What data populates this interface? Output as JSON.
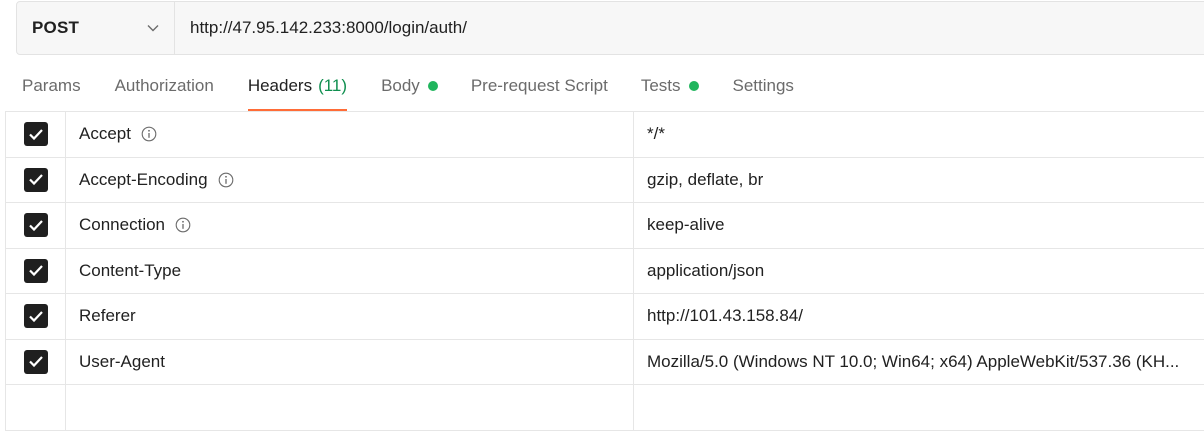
{
  "request": {
    "method": "POST",
    "url": "http://47.95.142.233:8000/login/auth/"
  },
  "tabs": {
    "params": "Params",
    "authorization": "Authorization",
    "headers": "Headers",
    "headers_count": "(11)",
    "body": "Body",
    "pre_request": "Pre-request Script",
    "tests": "Tests",
    "settings": "Settings",
    "active": "Headers"
  },
  "colors": {
    "active_underline": "#ff6c37",
    "status_dot": "#20b55d",
    "count_text": "#0f8f4f"
  },
  "headers": [
    {
      "checked": true,
      "key": "Accept",
      "value": "*/*",
      "info": true
    },
    {
      "checked": true,
      "key": "Accept-Encoding",
      "value": "gzip, deflate, br",
      "info": true
    },
    {
      "checked": true,
      "key": "Connection",
      "value": "keep-alive",
      "info": true
    },
    {
      "checked": true,
      "key": "Content-Type",
      "value": "application/json",
      "info": false
    },
    {
      "checked": true,
      "key": "Referer",
      "value": "http://101.43.158.84/",
      "info": false
    },
    {
      "checked": true,
      "key": "User-Agent",
      "value": "Mozilla/5.0 (Windows NT 10.0; Win64; x64) AppleWebKit/537.36 (KH...",
      "info": false
    }
  ]
}
